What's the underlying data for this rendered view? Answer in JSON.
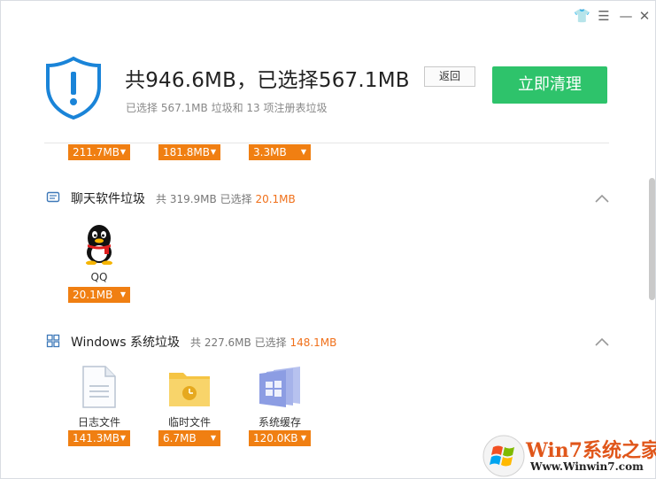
{
  "window": {
    "controls": {
      "skin_icon": "tshirt-icon",
      "menu_icon": "menu-icon",
      "min_icon": "minimize-icon",
      "close_icon": "close-icon",
      "skin_glyph": "👕",
      "menu_glyph": "☰",
      "min_glyph": "—",
      "close_glyph": "✕"
    }
  },
  "header": {
    "icon": "shield-alert-icon",
    "headline": "共946.6MB，已选择567.1MB",
    "back_label": "返回",
    "clean_label": "立即清理",
    "subline": "已选择 567.1MB 垃圾和 13 项注册表垃圾"
  },
  "top_row": {
    "sizes": [
      "211.7MB",
      "181.8MB",
      "3.3MB"
    ]
  },
  "sections": [
    {
      "icon": "chat-icon",
      "title": "聊天软件垃圾",
      "total": "共 319.9MB",
      "selected_label": "已选择",
      "selected_value": "20.1MB",
      "items": [
        {
          "icon": "qq-penguin-icon",
          "label": "QQ",
          "size": "20.1MB"
        }
      ]
    },
    {
      "icon": "windows-icon",
      "title": "Windows 系统垃圾",
      "total": "共 227.6MB",
      "selected_label": "已选择",
      "selected_value": "148.1MB",
      "items": [
        {
          "icon": "document-icon",
          "label": "日志文件",
          "size": "141.3MB"
        },
        {
          "icon": "folder-clock-icon",
          "label": "临时文件",
          "size": "6.7MB"
        },
        {
          "icon": "system-cache-icon",
          "label": "系统缓存",
          "size": "120.0KB"
        }
      ]
    }
  ],
  "watermark": {
    "line1": "Win7系统之家",
    "line2": "Www.Winwin7.com"
  },
  "colors": {
    "accent_green": "#2ec36b",
    "pill_orange": "#f07f12",
    "highlight_orange": "#f0701a",
    "shield_blue": "#1a84d8"
  }
}
